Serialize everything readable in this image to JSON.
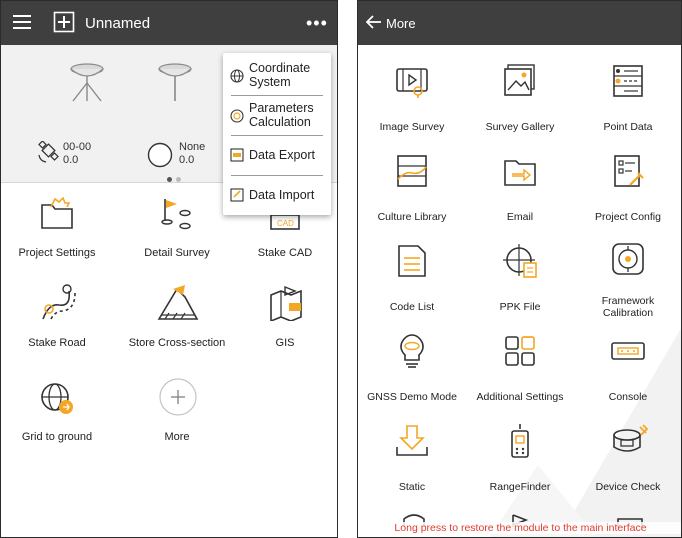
{
  "colors": {
    "topbar": "#3f3f3f",
    "accent_orange": "#f5a623",
    "icon_dark": "#333333",
    "hint_red": "#e23a2e"
  },
  "left": {
    "title": "Unnamed",
    "status": {
      "satellite_label": "00-00",
      "satellite_value": "0.0",
      "position_label": "None",
      "position_value": "0.0"
    },
    "menu": [
      {
        "label": "Coordinate System",
        "icon": "globe-icon"
      },
      {
        "label": "Parameters Calculation",
        "icon": "calc-globe-icon"
      },
      {
        "label": "Data Export",
        "icon": "export-icon"
      },
      {
        "label": "Data Import",
        "icon": "import-icon"
      }
    ],
    "grid": [
      {
        "label": "Project Settings",
        "icon": "folder-gear-icon"
      },
      {
        "label": "Detail Survey",
        "icon": "flag-survey-icon"
      },
      {
        "label": "Stake CAD",
        "icon": "cad-icon"
      },
      {
        "label": "Stake Road",
        "icon": "road-icon"
      },
      {
        "label": "Store Cross-section",
        "icon": "cross-section-icon"
      },
      {
        "label": "GIS",
        "icon": "gis-icon"
      },
      {
        "label": "Grid to ground",
        "icon": "grid-globe-icon"
      },
      {
        "label": "More",
        "icon": "plus-icon"
      }
    ]
  },
  "right": {
    "title": "More",
    "grid": [
      {
        "label": "Image Survey",
        "icon": "image-survey-icon"
      },
      {
        "label": "Survey Gallery",
        "icon": "gallery-icon"
      },
      {
        "label": "Point Data",
        "icon": "point-data-icon"
      },
      {
        "label": "Culture Library",
        "icon": "culture-library-icon"
      },
      {
        "label": "Email",
        "icon": "email-icon"
      },
      {
        "label": "Project Config",
        "icon": "project-config-icon"
      },
      {
        "label": "Code List",
        "icon": "code-list-icon"
      },
      {
        "label": "PPK File",
        "icon": "ppk-file-icon"
      },
      {
        "label": "Framework Calibration",
        "icon": "framework-calibration-icon"
      },
      {
        "label": "GNSS Demo Mode",
        "icon": "bulb-icon"
      },
      {
        "label": "Additional Settings",
        "icon": "apps-icon"
      },
      {
        "label": "Console",
        "icon": "console-icon"
      },
      {
        "label": "Static",
        "icon": "static-download-icon"
      },
      {
        "label": "RangeFinder",
        "icon": "rangefinder-icon"
      },
      {
        "label": "Device Check",
        "icon": "device-check-icon"
      }
    ],
    "hint": "Long press to restore the module to the main interface"
  }
}
